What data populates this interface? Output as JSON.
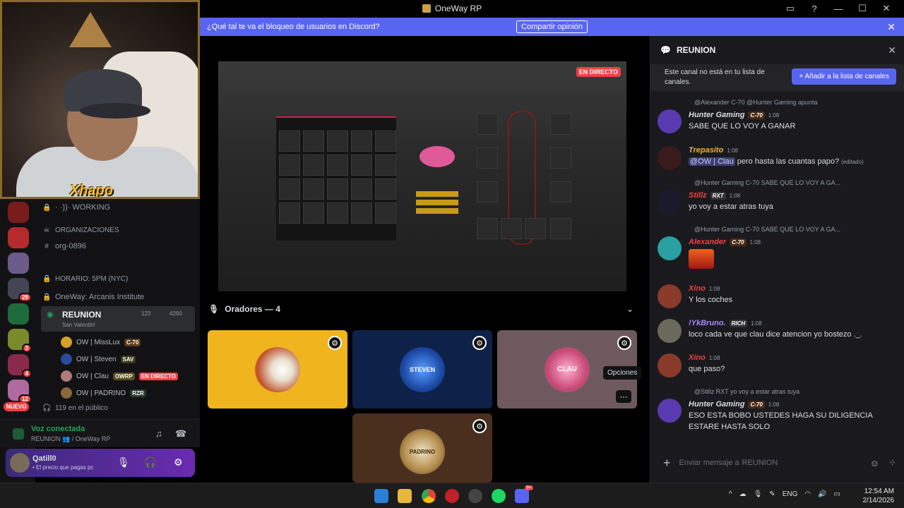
{
  "window": {
    "title": "OneWay RP",
    "controls": [
      "▭",
      "?",
      "—",
      "☐",
      "✕"
    ]
  },
  "banner": {
    "message": "¿Qué tal te va el bloqueo de usuarios en Discord?",
    "button": "Compartir opinión"
  },
  "webcam": {
    "overlay_name": "Xhapo"
  },
  "rail": {
    "badges": [
      "29",
      "3",
      "4",
      "12"
    ],
    "new_label": "NUEVO"
  },
  "channels": {
    "working": "· ·))· WORKING",
    "category": "ORGANIZACIONES",
    "org": "org-0896",
    "horario": "HORARIO: 5PM (NYC)",
    "institute": "OneWay: Arcanis Institute",
    "voice_channel": "REUNION",
    "voice_subtitle": "San Valentin!",
    "voice_count": "123",
    "voice_count2": "4260",
    "users": [
      {
        "name": "OW | MissLux",
        "tag": "C-70"
      },
      {
        "name": "OW | Steven",
        "tag": "SAV"
      },
      {
        "name": "OW | Clau",
        "tag": "OWRP",
        "live": "EN DIRECTO"
      },
      {
        "name": "OW | PADRINO",
        "tag": "RZR"
      }
    ],
    "public": "119 en el público"
  },
  "voice_panel": {
    "status": "Voz conectada",
    "location": "REUNION 👥 / OneWay RP"
  },
  "user_panel": {
    "name": "Qatill0",
    "status": "• El precio que pagas pc"
  },
  "stage": {
    "live_badge": "EN DIRECTO",
    "speakers_label": "Oradores — 4",
    "tooltip": "Opciones",
    "tile_labels": {
      "steven": "STEVEN",
      "clau": "CLAU",
      "padrino": "PADRINO"
    }
  },
  "chat": {
    "title": "REUNION",
    "notice": "Este canal no está en tu lista de canales.",
    "add_button": "+ Añadir a la lista de canales",
    "messages": [
      {
        "reply": "@Alexander C-70 @Hunter Gaming apunta",
        "author": "Hunter Gaming",
        "tag": "C-70",
        "time": "1:08",
        "text": "SABE QUE LO VOY A GANAR",
        "author_color": "#dbdee1"
      },
      {
        "reply": "",
        "author": "Trepasito",
        "tag": "",
        "time": "1:08",
        "text": "pero hasta las cuantas papo?",
        "mention": "@OW | Clau",
        "edited": "(editado)",
        "author_color": "#f0b232"
      },
      {
        "reply": "@Hunter Gaming C-70 SABE QUE LO VOY A GA...",
        "author": "Stillz",
        "tag": "RXT",
        "time": "1:08",
        "text": "yo voy a estar atras tuya",
        "author_color": "#f23f43"
      },
      {
        "reply": "@Hunter Gaming C-70 SABE QUE LO VOY A GA...",
        "author": "Alexander",
        "tag": "C-70",
        "time": "1:08",
        "text": "",
        "author_color": "#f23f43"
      },
      {
        "reply": "",
        "author": "Xino",
        "tag": "",
        "time": "1:08",
        "text": "Y los coches",
        "author_color": "#f23f43"
      },
      {
        "reply": "",
        "author": "!YkBruno.",
        "tag": "RICH",
        "time": "1:08",
        "text": "loco cada ve que clau dice atencion yo bostezo ._.",
        "author_color": "#a58cff"
      },
      {
        "reply": "",
        "author": "Xino",
        "tag": "",
        "time": "1:08",
        "text": "que paso?",
        "author_color": "#f23f43"
      },
      {
        "reply": "@Stillz RXT yo voy a estar atras tuya",
        "author": "Hunter Gaming",
        "tag": "C-70",
        "time": "1:08",
        "text": "ESO ESTA BOBO USTEDES HAGA SU DILIGENCIA",
        "text2": "ESTARE HASTA SOLO",
        "author_color": "#dbdee1"
      }
    ],
    "input_placeholder": "Enviar mensaje a",
    "input_channel": "REUNION"
  },
  "taskbar": {
    "lang": "ENG",
    "time": "12:54 AM",
    "date": "2/14/2026",
    "discord_badge": "9+"
  }
}
